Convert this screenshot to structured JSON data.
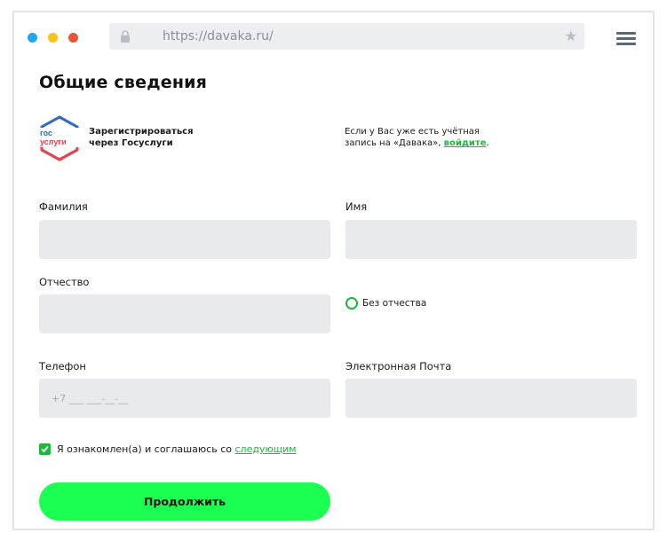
{
  "browser": {
    "url": "https://davaka.ru/",
    "icons": {
      "lock": "lock-icon",
      "star": "star-icon",
      "menu": "hamburger-menu-icon"
    },
    "window_dots": [
      "#1fa8f2",
      "#f7c21b",
      "#ec5233"
    ]
  },
  "page": {
    "title": "Общие сведения",
    "gosuslugi": {
      "logo_top": "гос",
      "logo_bottom": "услуги",
      "line1": "Зарегистрироваться",
      "line2": "через Госуслуги"
    },
    "login_note": {
      "line1": "Если у Вас уже есть учётная",
      "line2_prefix": "запись на «Давака», ",
      "link": "войдите",
      "line2_suffix": "."
    },
    "fields": {
      "surname_label": "Фамилия",
      "name_label": "Имя",
      "patronymic_label": "Отчество",
      "no_patronymic_label": "Без отчества",
      "phone_label": "Телефон",
      "phone_placeholder": "+7 ___ ___-__-__",
      "email_label": "Электронная Почта"
    },
    "agreement": {
      "text": "Я ознакомлен(а) и соглашаюсь со ",
      "link": "следующим",
      "checked": true
    },
    "submit_label": "Продолжить"
  },
  "colors": {
    "accent_green": "#1db83a",
    "button_green": "#1aff52",
    "field_bg": "#e8eaed"
  }
}
